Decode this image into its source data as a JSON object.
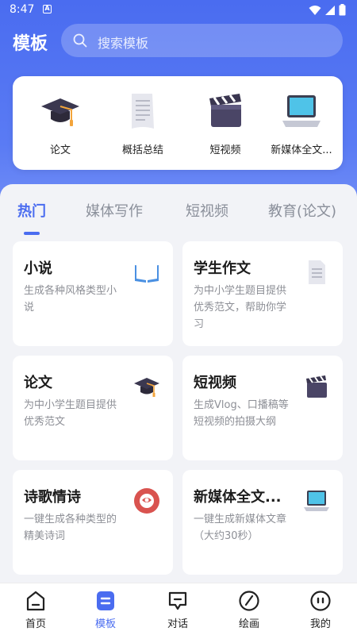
{
  "status_bar": {
    "time": "8:47",
    "notice": "A"
  },
  "header": {
    "title": "模板",
    "search_placeholder": "搜索模板"
  },
  "quick_items": [
    {
      "label": "论文",
      "icon": "graduation-cap-icon"
    },
    {
      "label": "概括总结",
      "icon": "document-icon"
    },
    {
      "label": "短视频",
      "icon": "clapperboard-icon"
    },
    {
      "label": "新媒体全文...",
      "icon": "laptop-icon"
    }
  ],
  "tabs": [
    {
      "label": "热门",
      "active": true
    },
    {
      "label": "媒体写作",
      "active": false
    },
    {
      "label": "短视频",
      "active": false
    },
    {
      "label": "教育(论文)",
      "active": false
    }
  ],
  "cards": [
    {
      "title": "小说",
      "desc": "生成各种风格类型小说",
      "icon": "book-icon"
    },
    {
      "title": "学生作文",
      "desc": "为中小学生题目提供优秀范文，帮助你学习",
      "icon": "document-icon"
    },
    {
      "title": "论文",
      "desc": "为中小学生题目提供优秀范文",
      "icon": "graduation-cap-icon"
    },
    {
      "title": "短视频",
      "desc": "生成Vlog、口播稿等短视频的拍摄大纲",
      "icon": "clapperboard-icon"
    },
    {
      "title": "诗歌情诗",
      "desc": "一键生成各种类型的精美诗词",
      "icon": "poem-badge-icon"
    },
    {
      "title": "新媒体全文...",
      "desc": "一键生成新媒体文章（大约30秒）",
      "icon": "laptop-icon"
    }
  ],
  "bottom_nav": [
    {
      "label": "首页",
      "icon": "home-icon",
      "active": false
    },
    {
      "label": "模板",
      "icon": "template-icon",
      "active": true
    },
    {
      "label": "对话",
      "icon": "chat-icon",
      "active": false
    },
    {
      "label": "绘画",
      "icon": "compass-icon",
      "active": false
    },
    {
      "label": "我的",
      "icon": "profile-icon",
      "active": false
    }
  ],
  "colors": {
    "accent": "#4a6cf0",
    "header_bg": "#5a7bf4",
    "page_bg": "#f2f3f7"
  }
}
